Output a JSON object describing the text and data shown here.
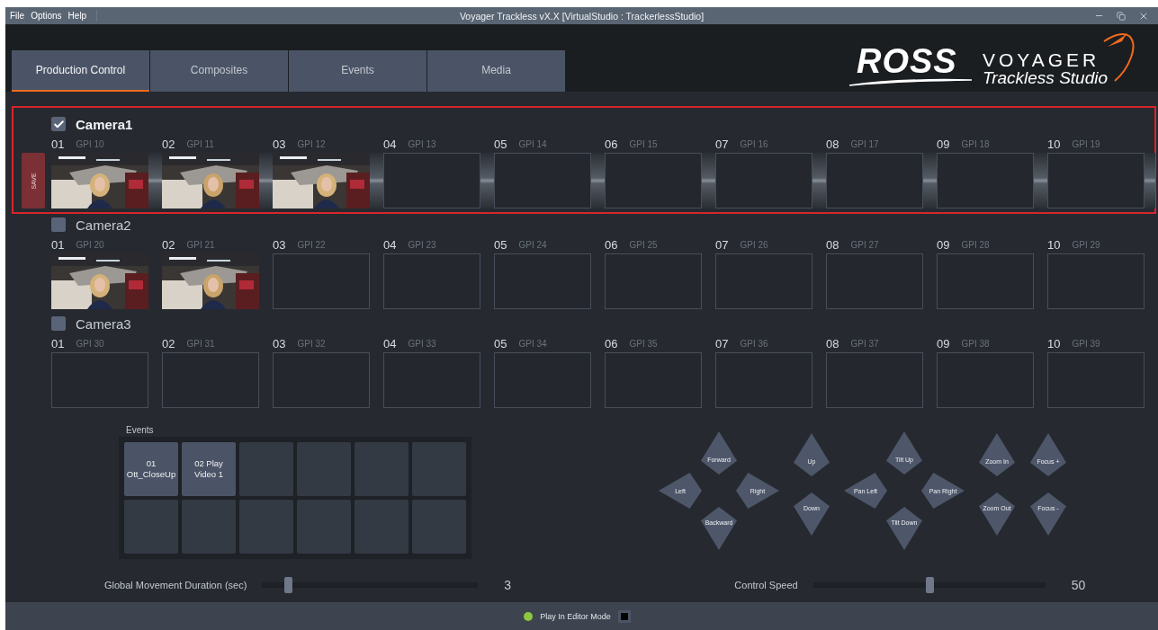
{
  "menu": [
    "File",
    "Options",
    "Help"
  ],
  "window": {
    "title": "Voyager Trackless vX.X [VirtualStudio : TrackerlessStudio]"
  },
  "tabs": [
    {
      "label": "Production Control",
      "selected": true
    },
    {
      "label": "Composites",
      "selected": false
    },
    {
      "label": "Events",
      "selected": false
    },
    {
      "label": "Media",
      "selected": false
    }
  ],
  "logo": {
    "brand": "ROSS",
    "product": "VOYAGER",
    "subtitle": "Trackless Studio"
  },
  "save_button": "SAVE",
  "cameras": [
    {
      "name": "Camera1",
      "checked": true,
      "selected": true,
      "slots": [
        {
          "number": "01",
          "gpi": "GPI 10",
          "kind": "picture"
        },
        {
          "number": "02",
          "gpi": "GPI 11",
          "kind": "picture"
        },
        {
          "number": "03",
          "gpi": "GPI 12",
          "kind": "picture"
        },
        {
          "number": "04",
          "gpi": "GPI 13",
          "kind": "empty"
        },
        {
          "number": "05",
          "gpi": "GPI 14",
          "kind": "empty"
        },
        {
          "number": "06",
          "gpi": "GPI 15",
          "kind": "empty"
        },
        {
          "number": "07",
          "gpi": "GPI 16",
          "kind": "empty"
        },
        {
          "number": "08",
          "gpi": "GPI 17",
          "kind": "empty"
        },
        {
          "number": "09",
          "gpi": "GPI 18",
          "kind": "empty"
        },
        {
          "number": "10",
          "gpi": "GPI 19",
          "kind": "empty"
        }
      ]
    },
    {
      "name": "Camera2",
      "checked": false,
      "selected": false,
      "slots": [
        {
          "number": "01",
          "gpi": "GPI 20",
          "kind": "picture"
        },
        {
          "number": "02",
          "gpi": "GPI 21",
          "kind": "picture"
        },
        {
          "number": "03",
          "gpi": "GPI 22",
          "kind": "empty"
        },
        {
          "number": "04",
          "gpi": "GPI 23",
          "kind": "empty"
        },
        {
          "number": "05",
          "gpi": "GPI 24",
          "kind": "empty"
        },
        {
          "number": "06",
          "gpi": "GPI 25",
          "kind": "empty"
        },
        {
          "number": "07",
          "gpi": "GPI 26",
          "kind": "empty"
        },
        {
          "number": "08",
          "gpi": "GPI 27",
          "kind": "empty"
        },
        {
          "number": "09",
          "gpi": "GPI 28",
          "kind": "empty"
        },
        {
          "number": "10",
          "gpi": "GPI 29",
          "kind": "empty"
        }
      ]
    },
    {
      "name": "Camera3",
      "checked": false,
      "selected": false,
      "slots": [
        {
          "number": "01",
          "gpi": "GPI 30",
          "kind": "empty"
        },
        {
          "number": "02",
          "gpi": "GPI 31",
          "kind": "empty"
        },
        {
          "number": "03",
          "gpi": "GPI 32",
          "kind": "empty"
        },
        {
          "number": "04",
          "gpi": "GPI 33",
          "kind": "empty"
        },
        {
          "number": "05",
          "gpi": "GPI 34",
          "kind": "empty"
        },
        {
          "number": "06",
          "gpi": "GPI 35",
          "kind": "empty"
        },
        {
          "number": "07",
          "gpi": "GPI 36",
          "kind": "empty"
        },
        {
          "number": "08",
          "gpi": "GPI 37",
          "kind": "empty"
        },
        {
          "number": "09",
          "gpi": "GPI 38",
          "kind": "empty"
        },
        {
          "number": "10",
          "gpi": "GPI 39",
          "kind": "empty"
        }
      ]
    }
  ],
  "events": {
    "title": "Events",
    "cells": [
      {
        "label": "01 Ott_CloseUp",
        "assigned": true
      },
      {
        "label": "02 Play Video 1",
        "assigned": true
      },
      {
        "assigned": false
      },
      {
        "assigned": false
      },
      {
        "assigned": false
      },
      {
        "assigned": false
      },
      {
        "assigned": false
      },
      {
        "assigned": false
      },
      {
        "assigned": false
      },
      {
        "assigned": false
      },
      {
        "assigned": false
      },
      {
        "assigned": false
      }
    ]
  },
  "pads": [
    {
      "kind": "cross",
      "buttons": [
        {
          "label": "Forward",
          "kind": "up"
        },
        {
          "label": "Left",
          "kind": "left"
        },
        {
          "label": "Right",
          "kind": "right"
        },
        {
          "label": "Backward",
          "kind": "down"
        }
      ]
    },
    {
      "kind": "column",
      "buttons": [
        {
          "label": "Up",
          "kind": "up"
        },
        {
          "label": "Down",
          "kind": "down"
        }
      ]
    },
    {
      "kind": "cross",
      "buttons": [
        {
          "label": "Tilt Up",
          "kind": "up"
        },
        {
          "label": "Pan Left",
          "kind": "left"
        },
        {
          "label": "Pan Right",
          "kind": "right"
        },
        {
          "label": "Tilt Down",
          "kind": "down"
        }
      ]
    },
    {
      "kind": "column",
      "buttons": [
        {
          "label": "Zoom In",
          "kind": "up"
        },
        {
          "label": "Zoom Out",
          "kind": "down"
        }
      ]
    },
    {
      "kind": "column",
      "buttons": [
        {
          "label": "Focus +",
          "kind": "up"
        },
        {
          "label": "Focus -",
          "kind": "down"
        }
      ]
    }
  ],
  "sliders": [
    {
      "label": "Global Movement Duration (sec)",
      "level": 0.12,
      "reading": "3"
    },
    {
      "label": "Control Speed",
      "level": 0.5,
      "reading": "50"
    }
  ],
  "status_bar": {
    "label": "Play In Editor Mode",
    "checked": false
  }
}
